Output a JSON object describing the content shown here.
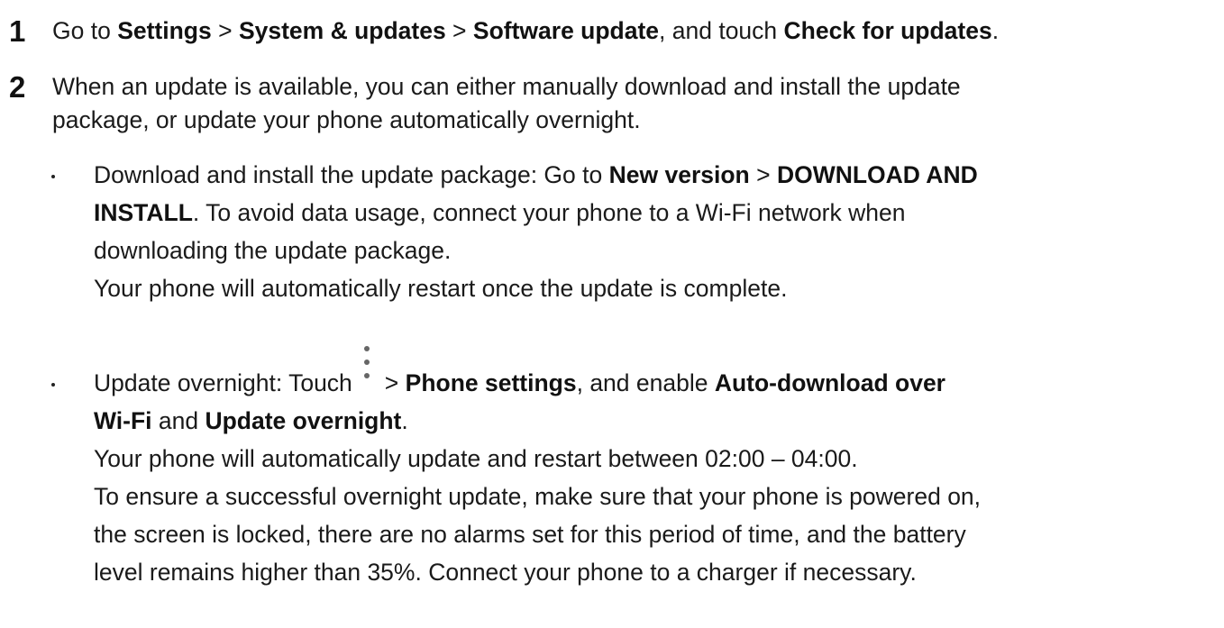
{
  "step1": {
    "number": "1",
    "t1": "Go to ",
    "b1": "Settings",
    "t2": " > ",
    "b2": "System & updates",
    "t3": " > ",
    "b3": "Software update",
    "t4": ", and touch ",
    "b4": "Check for updates",
    "t5": "."
  },
  "step2": {
    "number": "2",
    "line1": "When an update is available, you can either manually download and install the update",
    "line2": "package, or update your phone automatically overnight."
  },
  "bullet1": {
    "t1": "Download and install the update package: Go to ",
    "b1": "New version",
    "t2": " > ",
    "b2": "DOWNLOAD AND",
    "b3": "INSTALL",
    "t3": ". To avoid data usage, connect your phone to a Wi-Fi network when",
    "line3": "downloading the update package.",
    "line4": "Your phone will automatically restart once the update is complete."
  },
  "bullet2": {
    "t1": "Update overnight: Touch",
    "icon": "more-vertical-icon",
    "t2": "> ",
    "b1": "Phone settings",
    "t3": ", and enable ",
    "b2": "Auto-download over",
    "b3": "Wi-Fi",
    "t4": " and ",
    "b4": "Update overnight",
    "t5": ".",
    "line3": "Your phone will automatically update and restart between 02:00 – 04:00.",
    "line4": "To ensure a successful overnight update, make sure that your phone is powered on,",
    "line5": "the screen is locked, there are no alarms set for this period of time, and the battery",
    "line6": "level remains higher than 35%. Connect your phone to a charger if necessary."
  }
}
